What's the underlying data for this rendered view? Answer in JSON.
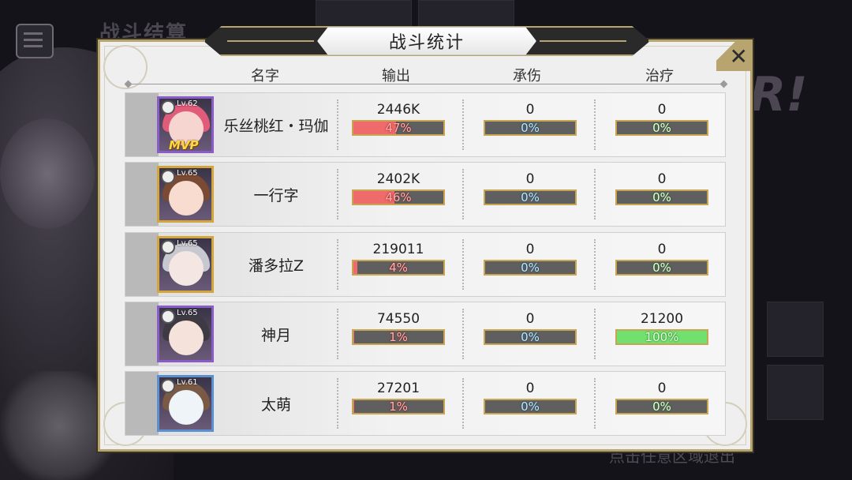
{
  "background": {
    "title": "战斗结算",
    "hint": "点击任意区域退出",
    "deco_text": "R!"
  },
  "panel": {
    "title": "战斗统计",
    "close_icon": "close-icon",
    "columns": [
      "名字",
      "输出",
      "承伤",
      "治疗"
    ]
  },
  "rows": [
    {
      "level": "Lv.62",
      "name": "乐丝桃红・玛伽",
      "mvp": "MVP",
      "frame": "purple",
      "hair": "#e05c7a",
      "face": "#f6d4cf",
      "output": {
        "value": "2446K",
        "percent": "47%",
        "fraction": 0.47
      },
      "damage_taken": {
        "value": "0",
        "percent": "0%",
        "fraction": 0
      },
      "healing": {
        "value": "0",
        "percent": "0%",
        "fraction": 0
      }
    },
    {
      "level": "Lv.65",
      "name": "一行字",
      "mvp": "",
      "frame": "gold",
      "hair": "#7a4a32",
      "face": "#f7dccf",
      "output": {
        "value": "2402K",
        "percent": "46%",
        "fraction": 0.46
      },
      "damage_taken": {
        "value": "0",
        "percent": "0%",
        "fraction": 0
      },
      "healing": {
        "value": "0",
        "percent": "0%",
        "fraction": 0
      }
    },
    {
      "level": "Lv.65",
      "name": "潘多拉Z",
      "mvp": "",
      "frame": "gold",
      "hair": "#c8c8d0",
      "face": "#f4e6e2",
      "output": {
        "value": "219011",
        "percent": "4%",
        "fraction": 0.04
      },
      "damage_taken": {
        "value": "0",
        "percent": "0%",
        "fraction": 0
      },
      "healing": {
        "value": "0",
        "percent": "0%",
        "fraction": 0
      }
    },
    {
      "level": "Lv.65",
      "name": "神月",
      "mvp": "",
      "frame": "purple",
      "hair": "#3e3a44",
      "face": "#f5e2da",
      "output": {
        "value": "74550",
        "percent": "1%",
        "fraction": 0.01
      },
      "damage_taken": {
        "value": "0",
        "percent": "0%",
        "fraction": 0
      },
      "healing": {
        "value": "21200",
        "percent": "100%",
        "fraction": 1.0
      }
    },
    {
      "level": "Lv.61",
      "name": "太萌",
      "mvp": "",
      "frame": "blue",
      "hair": "#7a5a44",
      "face": "#eef4f8",
      "output": {
        "value": "27201",
        "percent": "1%",
        "fraction": 0.01
      },
      "damage_taken": {
        "value": "0",
        "percent": "0%",
        "fraction": 0
      },
      "healing": {
        "value": "0",
        "percent": "0%",
        "fraction": 0
      }
    }
  ],
  "colors": {
    "accent_gold": "#b7a46e",
    "output_bar": "#ef6b6b",
    "healing_bar": "#71e06f",
    "bar_bg": "#5f5f5f"
  }
}
